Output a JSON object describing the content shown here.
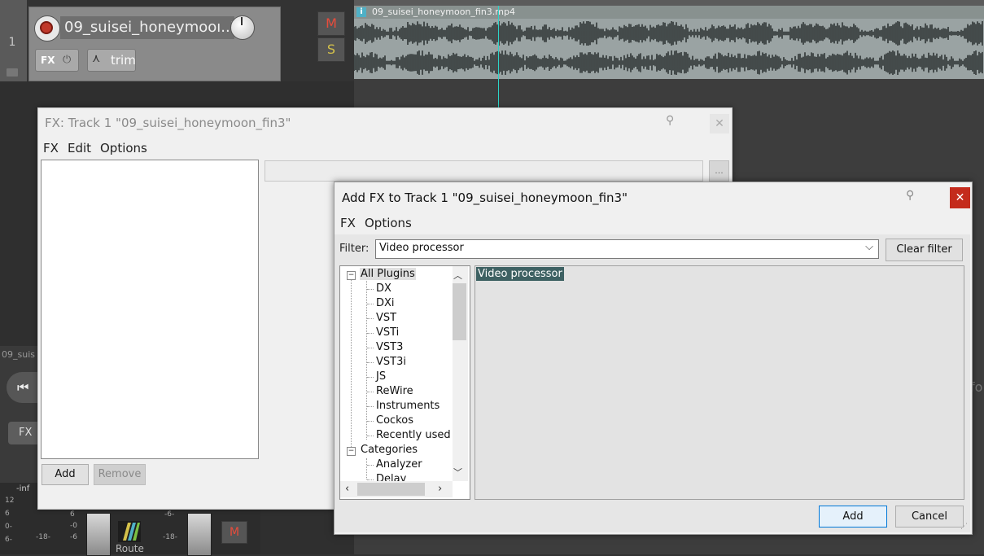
{
  "track": {
    "number": "1",
    "name": "09_suisei_honeymooı..3",
    "fx_label": "FX",
    "trim_label": "trim",
    "mute_label": "M",
    "solo_label": "S"
  },
  "media_item": {
    "icon": "i",
    "title": "09_suisei_honeymoon_fin3.mp4"
  },
  "mixer": {
    "track_label": "09_suis",
    "fx_label": "FX",
    "inf_label": "-inf",
    "scale_left": [
      "12",
      "6",
      "0-",
      "6-"
    ],
    "scale_mid": [
      "6",
      "-0",
      "-6"
    ],
    "scale_18a": "-18-",
    "scale_6b": "-6-",
    "scale_18b": "-18-",
    "route_label": "Route",
    "mute_label": "M",
    "right_edge_text": "fo"
  },
  "fx_window": {
    "title": "FX: Track 1 \"09_suisei_honeymoon_fin3\"",
    "menu": [
      "FX",
      "Edit",
      "Options"
    ],
    "add_label": "Add",
    "remove_label": "Remove",
    "dots_label": "..."
  },
  "add_fx_dialog": {
    "title": "Add FX to Track 1 \"09_suisei_honeymoon_fin3\"",
    "close_label": "✕",
    "menu": [
      "FX",
      "Options"
    ],
    "filter_label": "Filter:",
    "filter_value": "Video processor",
    "clear_filter_label": "Clear filter",
    "tree": {
      "root": "All Plugins",
      "plugin_types": [
        "DX",
        "DXi",
        "VST",
        "VSTi",
        "VST3",
        "VST3i",
        "JS",
        "ReWire",
        "Instruments",
        "Cockos",
        "Recently used"
      ],
      "categories_root": "Categories",
      "categories": [
        "Analyzer",
        "Delay"
      ]
    },
    "results": [
      "Video processor"
    ],
    "add_label": "Add",
    "cancel_label": "Cancel"
  },
  "colors": {
    "selection": "#3e6163",
    "close_red": "#c42b1c",
    "playhead": "#2bd4c8",
    "mute_red": "#e74c3c",
    "solo_yellow": "#d4c14a"
  }
}
